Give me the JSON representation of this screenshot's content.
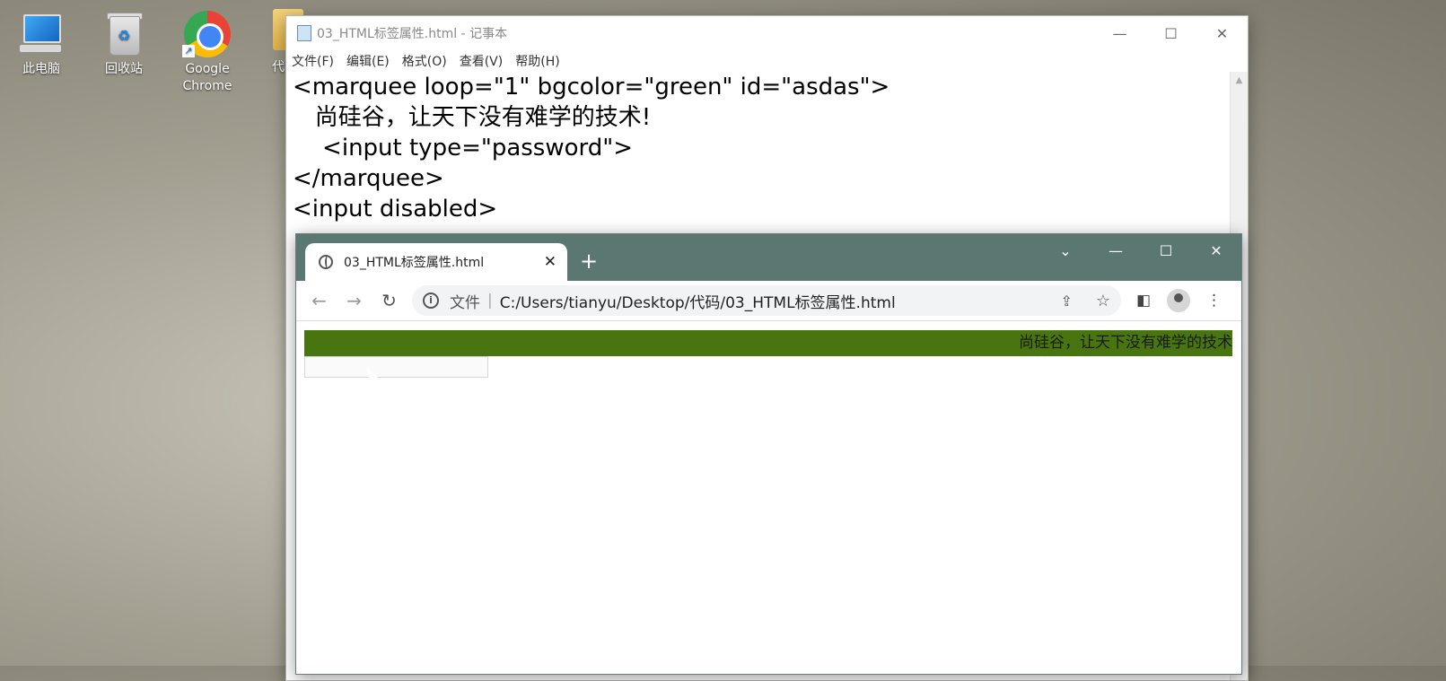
{
  "desktop": {
    "icons": [
      {
        "label": "此电脑"
      },
      {
        "label": "回收站"
      },
      {
        "label": "Google Chrome"
      },
      {
        "label": "代"
      }
    ]
  },
  "notepad": {
    "title": "03_HTML标签属性.html - 记事本",
    "controls": {
      "minimize": "—",
      "maximize": "☐",
      "close": "✕"
    },
    "menu": [
      "文件(F)",
      "编辑(E)",
      "格式(O)",
      "查看(V)",
      "帮助(H)"
    ],
    "lines": [
      "<marquee loop=\"1\" bgcolor=\"green\" id=\"asdas\">",
      "   尚硅谷，让天下没有难学的技术!",
      "    <input type=\"password\">",
      "</marquee>",
      "<input disabled>"
    ]
  },
  "browser": {
    "tab_title": "03_HTML标签属性.html",
    "tab_close": "✕",
    "new_tab": "+",
    "window_controls": {
      "dropdown": "⌄",
      "minimize": "—",
      "maximize": "☐",
      "close": "✕"
    },
    "nav": {
      "back": "←",
      "forward": "→",
      "reload": "↻"
    },
    "address": {
      "scheme_label": "文件",
      "separator": "|",
      "url": "C:/Users/tianyu/Desktop/代码/03_HTML标签属性.html"
    },
    "toolbar_icons": {
      "share": "⇪",
      "star": "☆",
      "sidepanel": "◧",
      "menu": "⋮"
    },
    "page": {
      "marquee_text": "尚硅谷，让天下没有难学的技术",
      "marquee_bg": "#48750f"
    }
  }
}
